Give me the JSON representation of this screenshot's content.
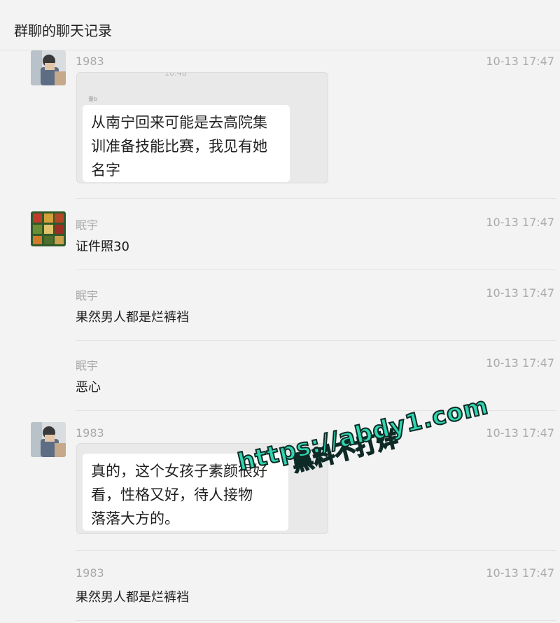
{
  "header": {
    "title": "群聊的聊天记录"
  },
  "messages": [
    {
      "sender": "1983",
      "time": "10-13 17:47",
      "type": "image",
      "faded_top": "10:48",
      "small_label": "量b",
      "bubble_lines": [
        "从南宁回来可能是去高院集",
        "训准备技能比赛，我见有她",
        "名字"
      ]
    },
    {
      "sender": "眠宇",
      "time": "10-13 17:47",
      "type": "text",
      "text": "证件照30"
    },
    {
      "sender": "眠宇",
      "time": "10-13 17:47",
      "type": "text",
      "text": "果然男人都是烂裤裆"
    },
    {
      "sender": "眠宇",
      "time": "10-13 17:47",
      "type": "text",
      "text": "恶心"
    },
    {
      "sender": "1983",
      "time": "10-13 17:47",
      "type": "image",
      "bubble_lines": [
        "真的，这个女孩子素颜很好",
        "看，性格又好，待人接物",
        "落落大方的。"
      ]
    },
    {
      "sender": "1983",
      "time": "10-13 17:47",
      "type": "text",
      "text": "果然男人都是烂裤裆"
    }
  ],
  "watermark": {
    "line1": "黑料不打烊",
    "line2": "https://abdy1.com"
  },
  "colors": {
    "background": "#f3f3f3",
    "muted_text": "#a9a9a9",
    "watermark": "#2fd6b0"
  },
  "icons": {
    "avatar_1983": "person-photo-avatar",
    "avatar_mianyu": "game-art-avatar"
  }
}
